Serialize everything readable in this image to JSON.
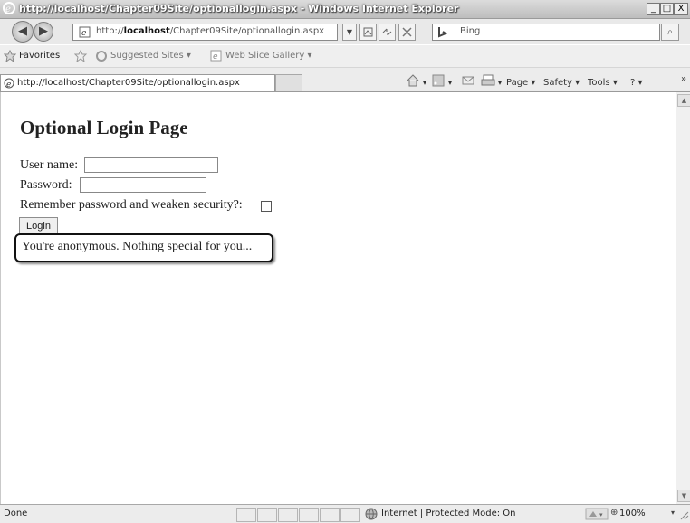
{
  "window": {
    "title": "http://localhost/Chapter09Site/optionallogin.aspx - Windows Internet Explorer",
    "minimize": "_",
    "maximize": "□",
    "close": "X"
  },
  "address_bar": {
    "url_prefix": "http://",
    "url_host": "localhost",
    "url_path": "/Chapter09Site/optionallogin.aspx",
    "back": "◀",
    "forward": "▶",
    "dropdown": "▼"
  },
  "search": {
    "provider": "Bing",
    "search_icon": "⌕"
  },
  "favorites_bar": {
    "favorites": "Favorites",
    "suggested_sites": "Suggested Sites ▾",
    "web_slice_gallery": "Web Slice Gallery ▾"
  },
  "tab": {
    "title": "http://localhost/Chapter09Site/optionallogin.aspx"
  },
  "command_bar": {
    "page": "Page ▾",
    "safety": "Safety ▾",
    "tools": "Tools ▾",
    "help": "? ▾",
    "more": "»"
  },
  "page": {
    "heading": "Optional Login Page",
    "username_label": "User name:",
    "username_value": "",
    "password_label": "Password:",
    "password_value": "",
    "remember_label": "Remember password and weaken security?:",
    "remember_checked": false,
    "login_button": "Login",
    "message": "You're anonymous. Nothing special for you..."
  },
  "status_bar": {
    "status": "Done",
    "zone": "Internet | Protected Mode: On",
    "zoom": "100%"
  },
  "colors": {
    "page_background": "#ffffff",
    "chrome_background": "#ececec",
    "message_border": "#111111"
  },
  "icons": [
    "ie-icon",
    "back-icon",
    "forward-icon",
    "page-icon",
    "compatibility-icon",
    "refresh-icon",
    "stop-icon",
    "bing-icon",
    "search-icon",
    "favorites-star-icon",
    "add-favorites-icon",
    "home-icon",
    "feeds-icon",
    "mail-icon",
    "print-icon",
    "help-icon",
    "globe-icon",
    "security-icon",
    "zoom-icon",
    "resize-grip-icon"
  ]
}
